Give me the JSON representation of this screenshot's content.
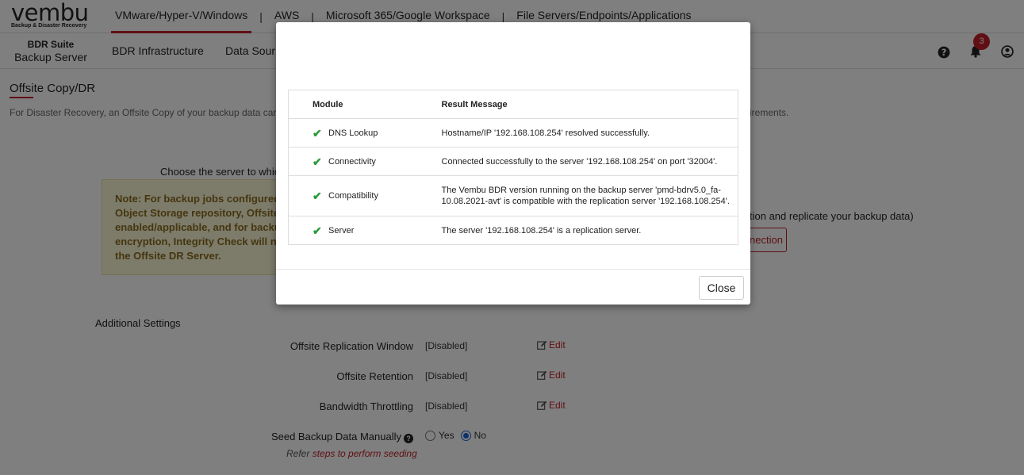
{
  "brand": {
    "logo_word": "vembu",
    "logo_tagline": "Backup & Disaster Recovery"
  },
  "product_tabs": [
    {
      "label": "VMware/Hyper-V/Windows"
    },
    {
      "label": "AWS"
    },
    {
      "label": "Microsoft 365/Google Workspace"
    },
    {
      "label": "File Servers/Endpoints/Applications"
    }
  ],
  "product_tab_separator": "|",
  "suite": {
    "line1": "BDR Suite",
    "line2": "Backup Server"
  },
  "menu": {
    "infrastructure": "BDR Infrastructure",
    "data_sources": "Data Sour"
  },
  "notifications": {
    "count": "3"
  },
  "page": {
    "title": "Offsite Copy/DR",
    "description": "For Disaster Recovery, an Offsite Copy of your backup data can b",
    "description_right": "irements.",
    "choose_server": "Choose the server to whic",
    "note_lines": [
      "Note: For backup jobs configured wi",
      "Object Storage repository, Offsite C",
      "enabled/applicable, and for backup jo",
      "encryption, Integrity Check will not",
      "the Offsite DR Server."
    ],
    "right_text": "tion and replicate your backup data)",
    "right_button": "nection"
  },
  "additional_settings": {
    "heading": "Additional Settings",
    "rows": [
      {
        "label": "Offsite Replication Window",
        "value": "[Disabled]",
        "edit": "Edit"
      },
      {
        "label": "Offsite Retention",
        "value": "[Disabled]",
        "edit": "Edit"
      },
      {
        "label": "Bandwidth Throttling",
        "value": "[Disabled]",
        "edit": "Edit"
      }
    ],
    "seed": {
      "label": "Seed Backup Data Manually",
      "help": "?",
      "yes": "Yes",
      "no": "No",
      "selected": "No"
    },
    "refer_prefix": "Refer",
    "refer_link": "steps to perform seeding"
  },
  "modal": {
    "columns": {
      "module": "Module",
      "message": "Result Message"
    },
    "rows": [
      {
        "module": "DNS Lookup",
        "message": "Hostname/IP '192.168.108.254' resolved successfully."
      },
      {
        "module": "Connectivity",
        "message": "Connected successfully to the server '192.168.108.254' on port '32004'."
      },
      {
        "module": "Compatibility",
        "message_line1": "The Vembu BDR version running on the backup server 'pmd-bdrv5.0_fa-",
        "message_line2": "10.08.2021-avt' is compatible with the replication server '192.168.108.254'."
      },
      {
        "module": "Server",
        "message": "The server '192.168.108.254' is a replication server."
      }
    ],
    "check_glyph": "✔",
    "close_label": "Close"
  },
  "colors": {
    "accent": "#c0202a",
    "note_bg": "#fbf7d4",
    "check": "#2a9a3a"
  }
}
